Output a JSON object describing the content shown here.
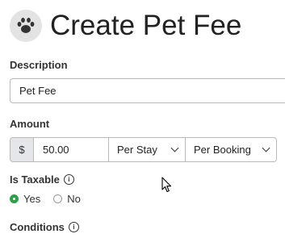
{
  "header": {
    "icon": "paw-icon",
    "title": "Create Pet Fee"
  },
  "description": {
    "label": "Description",
    "value": "Pet Fee"
  },
  "amount": {
    "label": "Amount",
    "currency_symbol": "$",
    "value": "50.00",
    "period_select": "Per Stay",
    "basis_select": "Per Booking"
  },
  "is_taxable": {
    "label": "Is Taxable",
    "info_icon": "info-icon",
    "options": [
      {
        "label": "Yes",
        "selected": true
      },
      {
        "label": "No",
        "selected": false
      }
    ]
  },
  "conditions": {
    "label": "Conditions",
    "info_icon": "info-icon"
  },
  "colors": {
    "accent": "#2e9e48",
    "addon_bg": "#e4e6e9",
    "border": "#b9b9b9"
  }
}
